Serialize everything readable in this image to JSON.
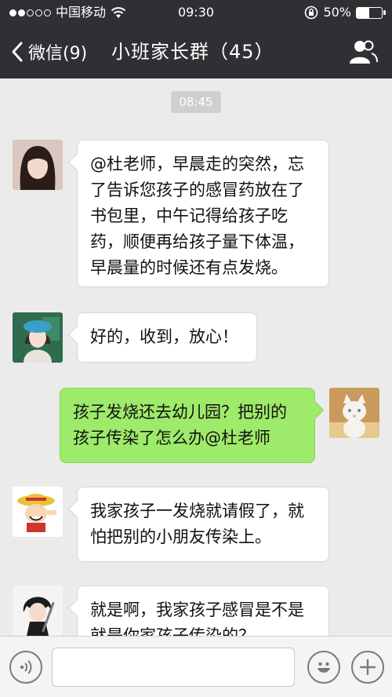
{
  "status_bar": {
    "carrier": "中国移动",
    "time": "09:30",
    "battery": "50%",
    "battery_level": 0.5
  },
  "nav": {
    "back_label": "微信(9)",
    "title": "小班家长群（45）"
  },
  "chat": {
    "timestamp": "08:45",
    "messages": [
      {
        "side": "left",
        "avatar": "girl-long-hair-avatar",
        "text": "@杜老师，早晨走的突然，忘了告诉您孩子的感冒药放在了书包里，中午记得给孩子吃药，顺便再给孩子量下体温，早晨量的时候还有点发烧。"
      },
      {
        "side": "left",
        "avatar": "girl-blue-hat-avatar",
        "text": "好的，收到，放心！"
      },
      {
        "side": "right",
        "avatar": "white-cat-avatar",
        "text": "孩子发烧还去幼儿园？把别的孩子传染了怎么办@杜老师"
      },
      {
        "side": "left",
        "avatar": "straw-hat-cartoon-avatar",
        "text": "我家孩子一发烧就请假了，就怕把别的小朋友传染上。"
      },
      {
        "side": "left",
        "avatar": "anime-character-avatar",
        "text": "就是啊，我家孩子感冒是不是就是你家孩子传染的？"
      }
    ]
  },
  "input_bar": {
    "placeholder": ""
  },
  "colors": {
    "header_bg": "#303034",
    "chat_bg": "#ebebeb",
    "outgoing_bubble": "#9eea6a",
    "incoming_bubble": "#ffffff"
  }
}
